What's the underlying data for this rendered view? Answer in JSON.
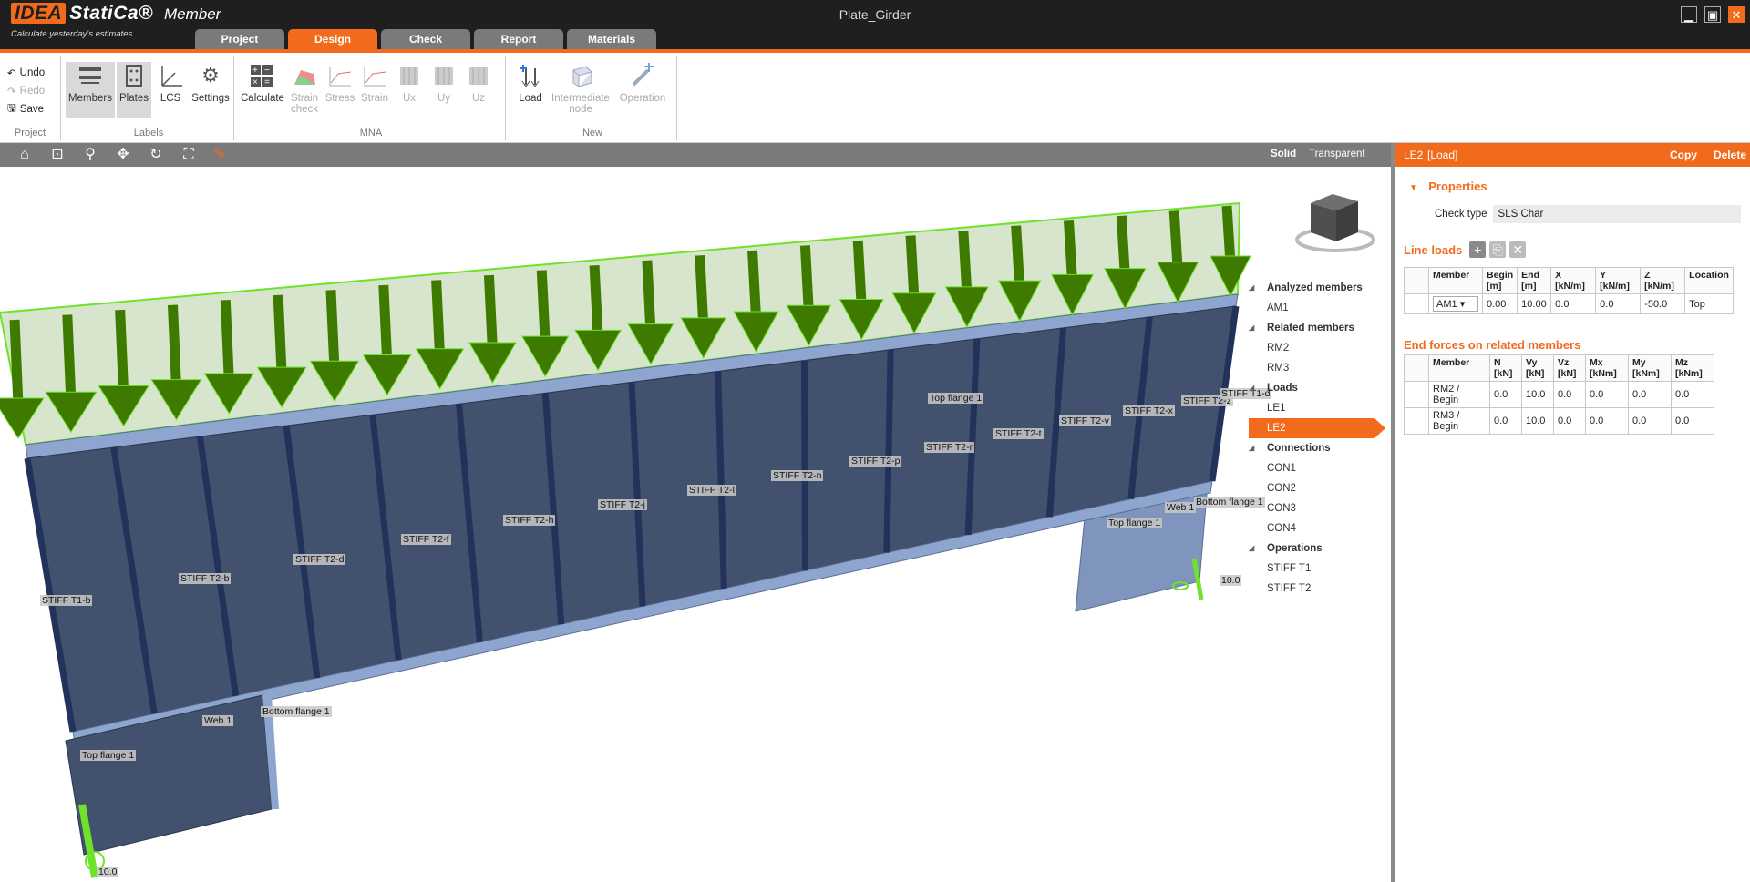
{
  "app": {
    "logo_idea": "IDEA",
    "logo_statica": "StatiCa®",
    "product": "Member",
    "tagline": "Calculate yesterday's estimates",
    "document_title": "Plate_Girder"
  },
  "window_controls": {
    "minimize": "▁",
    "maximize": "▣",
    "close": "✕"
  },
  "tabs": [
    {
      "label": "Project"
    },
    {
      "label": "Design"
    },
    {
      "label": "Check"
    },
    {
      "label": "Report"
    },
    {
      "label": "Materials"
    }
  ],
  "ribbon": {
    "project_group": {
      "undo": "Undo",
      "redo": "Redo",
      "save": "Save",
      "label": "Project"
    },
    "labels_group": {
      "members": "Members",
      "plates": "Plates",
      "lcs": "LCS",
      "settings": "Settings",
      "label": "Labels"
    },
    "mna_group": {
      "calculate": "Calculate",
      "strain_check_1": "Strain",
      "strain_check_2": "check",
      "stress": "Stress",
      "strain": "Strain",
      "ux": "Ux",
      "uy": "Uy",
      "uz": "Uz",
      "label": "MNA"
    },
    "new_group": {
      "load": "Load",
      "intermediate_1": "Intermediate",
      "intermediate_2": "node",
      "operation": "Operation",
      "label": "New"
    }
  },
  "view_modes": {
    "solid": "Solid",
    "transparent": "Transparent"
  },
  "model_labels": {
    "stiffeners": [
      "STIFF T1-b",
      "STIFF T2-b",
      "STIFF T2-d",
      "STIFF T2-f",
      "STIFF T2-h",
      "STIFF T2-j",
      "STIFF T2-l",
      "STIFF T2-n",
      "STIFF T2-p",
      "STIFF T2-r",
      "STIFF T2-t",
      "STIFF T2-v",
      "STIFF T2-x",
      "STIFF T2-z",
      "STIFF T1-d"
    ],
    "top_flange": "Top flange 1",
    "bottom_flange": "Bottom flange 1",
    "web": "Web 1",
    "support_value": "10.0"
  },
  "tree": {
    "analyzed_header": "Analyzed members",
    "analyzed": [
      "AM1"
    ],
    "related_header": "Related members",
    "related": [
      "RM2",
      "RM3"
    ],
    "loads_header": "Loads",
    "loads": [
      "LE1",
      "LE2"
    ],
    "connections_header": "Connections",
    "connections": [
      "CON1",
      "CON2",
      "CON3",
      "CON4"
    ],
    "operations_header": "Operations",
    "operations": [
      "STIFF T1",
      "STIFF T2"
    ]
  },
  "panel": {
    "header_name": "LE2",
    "header_type": "[Load]",
    "copy": "Copy",
    "delete": "Delete",
    "properties_title": "Properties",
    "check_type_label": "Check type",
    "check_type_value": "SLS Char",
    "line_loads_title": "Line loads",
    "line_loads_headers": {
      "member": "Member",
      "begin": "Begin [m]",
      "end": "End [m]",
      "x": "X [kN/m]",
      "y": "Y [kN/m]",
      "z": "Z [kN/m]",
      "location": "Location"
    },
    "line_loads_row": {
      "member": "AM1",
      "begin": "0.00",
      "end": "10.00",
      "x": "0.0",
      "y": "0.0",
      "z": "-50.0",
      "location": "Top"
    },
    "end_forces_title": "End forces on related members",
    "end_forces_headers": {
      "member": "Member",
      "n": "N [kN]",
      "vy": "Vy [kN]",
      "vz": "Vz [kN]",
      "mx": "Mx [kNm]",
      "my": "My [kNm]",
      "mz": "Mz [kNm]"
    },
    "end_forces_rows": [
      {
        "member": "RM2 / Begin",
        "n": "0.0",
        "vy": "10.0",
        "vz": "0.0",
        "mx": "0.0",
        "my": "0.0",
        "mz": "0.0"
      },
      {
        "member": "RM3 / Begin",
        "n": "0.0",
        "vy": "10.0",
        "vz": "0.0",
        "mx": "0.0",
        "my": "0.0",
        "mz": "0.0"
      }
    ]
  },
  "colors": {
    "accent": "#f26b1d",
    "titlebar": "#1f1f1f",
    "load": "#3f7a00",
    "steel": "#42516d"
  }
}
